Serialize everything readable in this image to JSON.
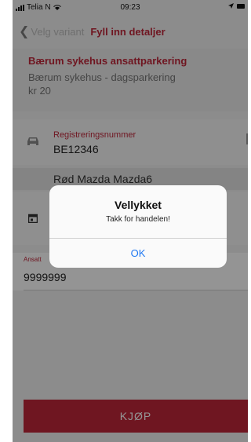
{
  "status_bar": {
    "carrier": "Telia N",
    "time": "09:23"
  },
  "nav": {
    "back_label": "Velg variant",
    "title": "Fyll inn detaljer"
  },
  "parking": {
    "title": "Bærum sykehus ansattparkering",
    "subtitle": "Bærum sykehus - dagsparkering",
    "price": "kr 20"
  },
  "registration": {
    "label": "Registreringsnummer",
    "value": "BE12346",
    "car_name": "Rød Mazda Mazda6"
  },
  "employee": {
    "label": "Ansatt",
    "value": "9999999"
  },
  "buy_button": {
    "label": "KJØP"
  },
  "alert": {
    "title": "Vellykket",
    "message": "Takk for handelen!",
    "ok_label": "OK"
  },
  "colors": {
    "accent": "#c0263a",
    "ios_blue": "#1f78f2"
  }
}
